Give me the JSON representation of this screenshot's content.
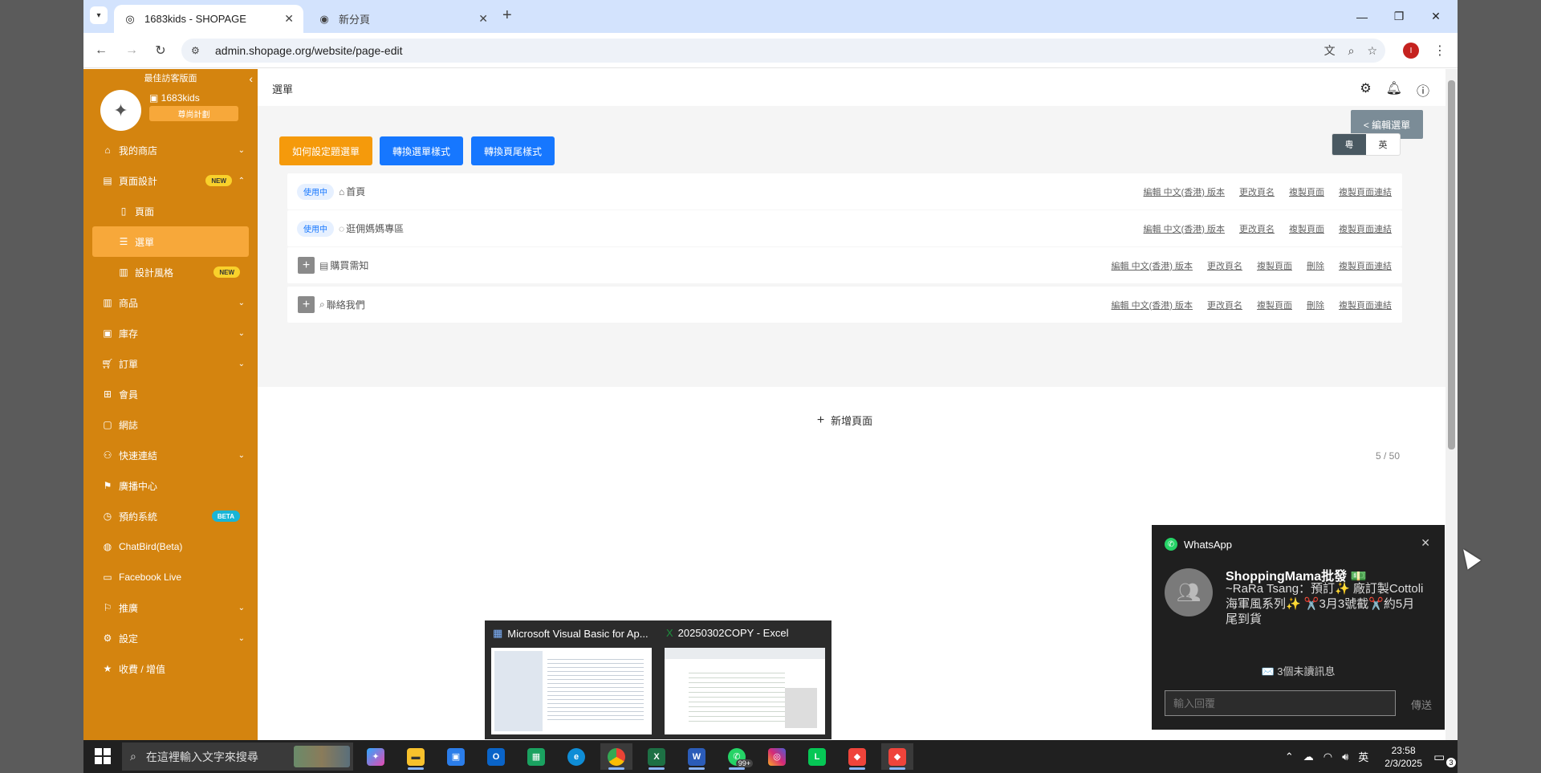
{
  "browser": {
    "tabs": [
      {
        "title": "1683kids - SHOPAGE",
        "active": true
      },
      {
        "title": "新分頁",
        "active": false
      }
    ],
    "url": "admin.shopage.org/website/page-edit",
    "profile_initial": "I"
  },
  "sidebar": {
    "top_label": "最佳訪客版面",
    "shop_name": "1683kids",
    "plan": "尊尚計劃",
    "items": [
      {
        "label": "我的商店",
        "icon": "home-icon",
        "chevron": "⌄"
      },
      {
        "label": "頁面設計",
        "icon": "layout-icon",
        "badge": "NEW",
        "chevron": "⌃"
      },
      {
        "label": "頁面",
        "icon": "document-icon",
        "sub": true
      },
      {
        "label": "選單",
        "icon": "list-icon",
        "sub": true,
        "active": true
      },
      {
        "label": "設計風格",
        "icon": "book-icon",
        "sub": true,
        "badge": "NEW"
      },
      {
        "label": "商品",
        "icon": "book-icon",
        "chevron": "⌄"
      },
      {
        "label": "庫存",
        "icon": "box-icon",
        "chevron": "⌄"
      },
      {
        "label": "訂單",
        "icon": "cart-icon",
        "chevron": "⌄"
      },
      {
        "label": "會員",
        "icon": "grid-icon"
      },
      {
        "label": "網誌",
        "icon": "lock-icon"
      },
      {
        "label": "快速連結",
        "icon": "link-icon",
        "chevron": "⌄"
      },
      {
        "label": "廣播中心",
        "icon": "broadcast-icon"
      },
      {
        "label": "預約系統",
        "icon": "clock-icon",
        "badge": "BETA"
      },
      {
        "label": "ChatBird(Beta)",
        "icon": "globe-icon"
      },
      {
        "label": "Facebook Live",
        "icon": "video-icon"
      },
      {
        "label": "推廣",
        "icon": "megaphone-icon",
        "chevron": "⌄"
      },
      {
        "label": "設定",
        "icon": "settings-icon",
        "chevron": "⌄"
      },
      {
        "label": "收費 / 增值",
        "icon": "star-icon"
      }
    ]
  },
  "main": {
    "title": "選單",
    "edit_menu_label": "< 編輯選單",
    "buttons": {
      "howto": "如何設定題選單",
      "switch_menu": "轉換選單樣式",
      "switch_footer": "轉換頁尾樣式"
    },
    "lang": {
      "yue": "粵",
      "en": "英"
    },
    "rows": [
      {
        "status": "使用中",
        "icon": "⌂",
        "name": "首頁",
        "actions": [
          "編輯 中文(香港) 版本",
          "更改頁名",
          "複製頁面",
          "複製頁面連結"
        ]
      },
      {
        "status": "使用中",
        "icon": "◌",
        "name": "逛佣媽媽專區",
        "actions": [
          "編輯 中文(香港) 版本",
          "更改頁名",
          "複製頁面",
          "複製頁面連結"
        ]
      },
      {
        "plus": "+",
        "icon": "▤",
        "name": "購買需知",
        "actions": [
          "編輯 中文(香港) 版本",
          "更改頁名",
          "複製頁面",
          "刪除",
          "複製頁面連結"
        ]
      },
      {
        "plus": "+",
        "icon": "⌕",
        "name": "聯絡我們",
        "actions": [
          "編輯 中文(香港) 版本",
          "更改頁名",
          "複製頁面",
          "刪除",
          "複製頁面連結"
        ]
      }
    ],
    "add_page": "新增頁面",
    "counter": "5 / 50"
  },
  "previews": [
    {
      "title": "Microsoft Visual Basic for Ap..."
    },
    {
      "title": "20250302COPY - Excel"
    }
  ],
  "toast": {
    "app": "WhatsApp",
    "sender": "ShoppingMama批發 💵",
    "message": "~RaRa Tsang：預訂✨ 廠訂製Cottoli海軍風系列✨ ✂️3月3號截✂️約5月尾到貨",
    "unread": "✉️ 3個未讀訊息",
    "reply_placeholder": "輸入回覆",
    "send": "傳送"
  },
  "taskbar": {
    "search_placeholder": "在這裡輸入文字來搜尋",
    "time": "23:58",
    "date": "2/3/2025",
    "ime": "英",
    "whatsapp_badge": "99+",
    "notifications": "3"
  }
}
